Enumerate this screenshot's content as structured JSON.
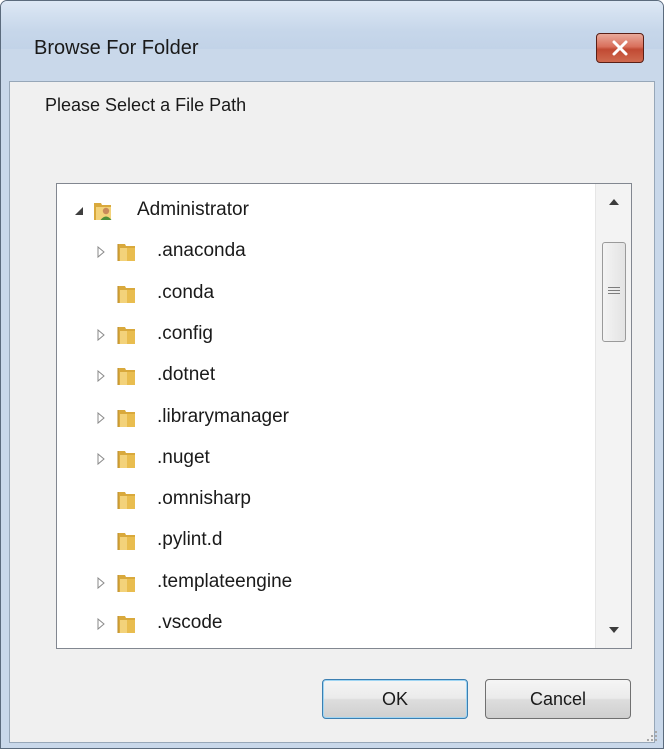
{
  "window": {
    "title": "Browse For Folder",
    "close_icon": "close-x-icon"
  },
  "prompt": "Please Select a File Path",
  "tree": {
    "root": {
      "label": "Administrator",
      "expanded": true,
      "icon": "user-folder-icon"
    },
    "items": [
      {
        "label": ".anaconda",
        "has_children": true
      },
      {
        "label": ".conda",
        "has_children": false
      },
      {
        "label": ".config",
        "has_children": true
      },
      {
        "label": ".dotnet",
        "has_children": true
      },
      {
        "label": ".librarymanager",
        "has_children": true
      },
      {
        "label": ".nuget",
        "has_children": true
      },
      {
        "label": ".omnisharp",
        "has_children": false
      },
      {
        "label": ".pylint.d",
        "has_children": false
      },
      {
        "label": ".templateengine",
        "has_children": true
      },
      {
        "label": ".vscode",
        "has_children": true
      }
    ]
  },
  "buttons": {
    "ok": "OK",
    "cancel": "Cancel"
  },
  "colors": {
    "folder": "#e9c86a",
    "close_button": "#c14a33"
  }
}
